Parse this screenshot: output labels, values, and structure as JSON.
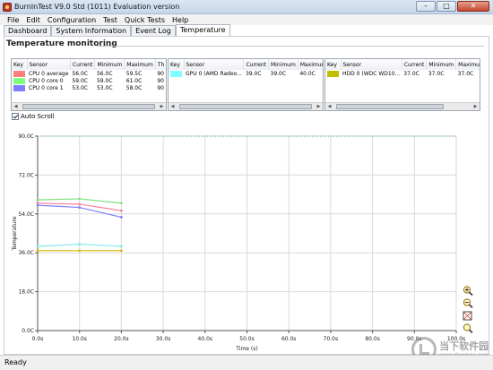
{
  "window": {
    "title": "BurnInTest V9.0 Std (1011) Evaluation version",
    "buttons": [
      "–",
      "□",
      "✕"
    ]
  },
  "menu": [
    "File",
    "Edit",
    "Configuration",
    "Test",
    "Quick Tests",
    "Help"
  ],
  "tabs": [
    {
      "label": "Dashboard",
      "active": false
    },
    {
      "label": "System Information",
      "active": false
    },
    {
      "label": "Event Log",
      "active": false
    },
    {
      "label": "Temperature",
      "active": true
    }
  ],
  "section_title": "Temperature monitoring",
  "sensor_panels": [
    {
      "columns": [
        "Key",
        "Sensor",
        "Current",
        "Minimum",
        "Maximum",
        "Th"
      ],
      "rows": [
        {
          "color": "#ff7f7f",
          "sensor": "CPU 0 average",
          "current": "56.0C",
          "minimum": "56.0C",
          "maximum": "59.5C",
          "th": "90"
        },
        {
          "color": "#7fff7f",
          "sensor": "CPU 0 core 0",
          "current": "59.0C",
          "minimum": "59.0C",
          "maximum": "61.0C",
          "th": "90"
        },
        {
          "color": "#7f7fff",
          "sensor": "CPU 0 core 1",
          "current": "53.0C",
          "minimum": "53.0C",
          "maximum": "58.0C",
          "th": "90"
        }
      ]
    },
    {
      "columns": [
        "Key",
        "Sensor",
        "Current",
        "Minimum",
        "Maximum",
        "Th"
      ],
      "rows": [
        {
          "color": "#7fffff",
          "sensor": "GPU 0 (AMD Radeo...",
          "current": "39.0C",
          "minimum": "39.0C",
          "maximum": "40.0C",
          "th": "90"
        }
      ]
    },
    {
      "columns": [
        "Key",
        "Sensor",
        "Current",
        "Minimum",
        "Maximum",
        "Th"
      ],
      "rows": [
        {
          "color": "#bfbf00",
          "sensor": "HDD 0 (WDC WD10...",
          "current": "37.0C",
          "minimum": "37.0C",
          "maximum": "37.0C",
          "th": "90"
        }
      ]
    }
  ],
  "auto_scroll": {
    "label": "Auto Scroll",
    "checked": true
  },
  "chart_data": {
    "type": "line",
    "xlabel": "Time (s)",
    "ylabel": "Temperature",
    "x_ticks": [
      "0.0s",
      "10.0s",
      "20.0s",
      "30.0s",
      "40.0s",
      "50.0s",
      "60.0s",
      "70.0s",
      "80.0s",
      "90.0s",
      "100.0s"
    ],
    "y_ticks": [
      "0.0C",
      "18.0C",
      "36.0C",
      "54.0C",
      "72.0C",
      "90.0C"
    ],
    "xlim": [
      0,
      100
    ],
    "ylim": [
      0,
      90
    ],
    "threshold": 90,
    "grid": true,
    "series": [
      {
        "color": "#7fe07f",
        "x": [
          0,
          10,
          20
        ],
        "values": [
          60.5,
          61.0,
          59.0
        ]
      },
      {
        "color": "#ff7f9f",
        "x": [
          0,
          10,
          20
        ],
        "values": [
          59.0,
          58.5,
          55.5
        ]
      },
      {
        "color": "#7f7fff",
        "x": [
          0,
          10,
          20
        ],
        "values": [
          58.0,
          57.0,
          52.5
        ]
      },
      {
        "color": "#7fe8ee",
        "x": [
          0,
          10,
          20
        ],
        "values": [
          39.0,
          40.0,
          39.0
        ]
      },
      {
        "color": "#d4b800",
        "x": [
          0,
          10,
          20
        ],
        "values": [
          37.0,
          37.0,
          37.0
        ]
      }
    ]
  },
  "zoom_tools": [
    "zoom-in-icon",
    "zoom-out-icon",
    "zoom-fit-icon",
    "zoom-reset-icon"
  ],
  "status": "Ready",
  "watermark": {
    "text": "当下软件园",
    "url": "www.downxia.com"
  }
}
